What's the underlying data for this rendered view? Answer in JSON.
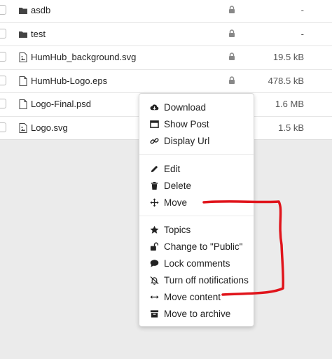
{
  "files": [
    {
      "name": "asdb",
      "type": "folder",
      "size": "-",
      "locked": true
    },
    {
      "name": "test",
      "type": "folder",
      "size": "-",
      "locked": true
    },
    {
      "name": "HumHub_background.svg",
      "type": "image",
      "size": "19.5 kB",
      "locked": true
    },
    {
      "name": "HumHub-Logo.eps",
      "type": "file",
      "size": "478.5 kB",
      "locked": true
    },
    {
      "name": "Logo-Final.psd",
      "type": "file",
      "size": "1.6 MB",
      "locked": false
    },
    {
      "name": "Logo.svg",
      "type": "image",
      "size": "1.5 kB",
      "locked": false
    }
  ],
  "context_menu": {
    "group1": [
      "Download",
      "Show Post",
      "Display Url"
    ],
    "group2": [
      "Edit",
      "Delete",
      "Move"
    ],
    "group3": [
      "Topics",
      "Change to \"Public\"",
      "Lock comments",
      "Turn off notifications",
      "Move content",
      "Move to archive"
    ]
  },
  "icons": {
    "Download": "cloud-download-icon",
    "Show Post": "window-icon",
    "Display Url": "link-icon",
    "Edit": "pencil-icon",
    "Delete": "trash-icon",
    "Move": "move-arrows-icon",
    "Topics": "star-icon",
    "Change to \"Public\"": "unlock-icon",
    "Lock comments": "comment-icon",
    "Turn off notifications": "bell-slash-icon",
    "Move content": "arrows-horizontal-icon",
    "Move to archive": "archive-icon"
  },
  "annotation_color": "#e0141b"
}
